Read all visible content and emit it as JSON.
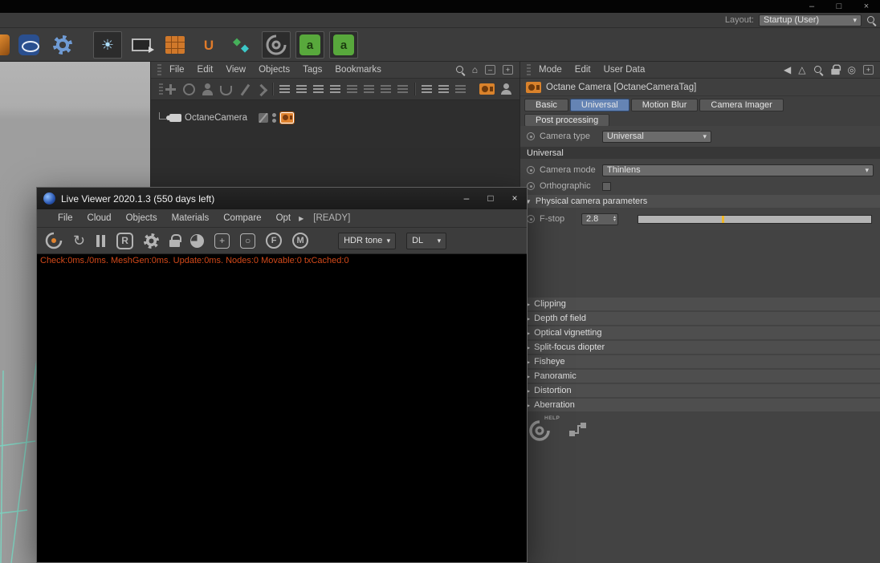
{
  "icons": {
    "minimize": "–",
    "maximize": "□",
    "close": "×",
    "dropdown_arrow": "▾",
    "collapsed_arrow": "▶",
    "expanded_arrow": "▼",
    "spin_up": "▴",
    "spin_down": "▾",
    "home": "⌂",
    "back_arrow": "◀",
    "forward_arrow": "△",
    "target": "◎",
    "refresh": "↻",
    "plus": "+",
    "minus": "–",
    "small_circle": "○",
    "menu_arrow": "▶",
    "sun": "☀",
    "uv_letter": "U",
    "texture_letter": "a",
    "node_diamond": "◆",
    "r_label": "R",
    "f_label": "F",
    "m_label": "M"
  },
  "layout_bar": {
    "label": "Layout:",
    "value": "Startup (User)"
  },
  "object_manager": {
    "menu": [
      "File",
      "Edit",
      "View",
      "Objects",
      "Tags",
      "Bookmarks"
    ],
    "objects": [
      {
        "name": "OctaneCamera"
      }
    ]
  },
  "attribute_manager": {
    "menu": [
      "Mode",
      "Edit",
      "User Data"
    ],
    "title": "Octane Camera [OctaneCameraTag]",
    "tabs": [
      "Basic",
      "Universal",
      "Motion Blur",
      "Camera Imager"
    ],
    "tab_post": "Post processing",
    "selected_tab": "Universal",
    "camera_type_label": "Camera type",
    "camera_type_value": "Universal",
    "section_universal": "Universal",
    "camera_mode_label": "Camera mode",
    "camera_mode_value": "Thinlens",
    "orthographic_label": "Orthographic",
    "orthographic_checked": false,
    "physical_section": "Physical camera parameters",
    "fstop_label": "F-stop",
    "fstop_value": "2.8",
    "fstop_slider_style": "left:36%",
    "sections": [
      "Clipping",
      "Depth of field",
      "Optical vignetting",
      "Split-focus diopter",
      "Fisheye",
      "Panoramic",
      "Distortion",
      "Aberration"
    ],
    "help_label": "HELP"
  },
  "live_viewer": {
    "title": "Live Viewer 2020.1.3 (550 days left)",
    "menu": [
      "File",
      "Cloud",
      "Objects",
      "Materials",
      "Compare",
      "Opt"
    ],
    "ready_label": "[READY]",
    "hdr_dropdown": "HDR tone",
    "dl_dropdown": "DL",
    "status": "Check:0ms./0ms. MeshGen:0ms. Update:0ms. Nodes:0 Movable:0 txCached:0"
  },
  "colors": {
    "accent_orange": "#e0832f",
    "tab_selected_blue": "#6584b4",
    "status_red": "#d2491a",
    "wireframe_teal": "#7fd2c0"
  }
}
